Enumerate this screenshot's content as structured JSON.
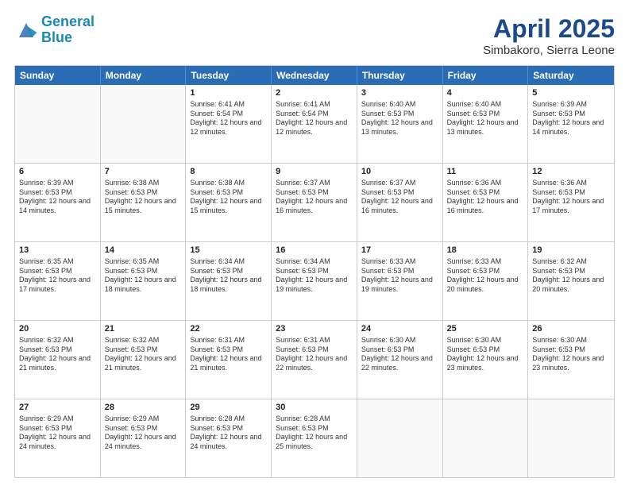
{
  "header": {
    "logo_line1": "General",
    "logo_line2": "Blue",
    "main_title": "April 2025",
    "subtitle": "Simbakoro, Sierra Leone"
  },
  "calendar": {
    "weekdays": [
      "Sunday",
      "Monday",
      "Tuesday",
      "Wednesday",
      "Thursday",
      "Friday",
      "Saturday"
    ],
    "rows": [
      [
        {
          "day": "",
          "empty": true
        },
        {
          "day": "",
          "empty": true
        },
        {
          "day": "1",
          "sunrise": "6:41 AM",
          "sunset": "6:54 PM",
          "daylight": "12 hours and 12 minutes."
        },
        {
          "day": "2",
          "sunrise": "6:41 AM",
          "sunset": "6:54 PM",
          "daylight": "12 hours and 12 minutes."
        },
        {
          "day": "3",
          "sunrise": "6:40 AM",
          "sunset": "6:53 PM",
          "daylight": "12 hours and 13 minutes."
        },
        {
          "day": "4",
          "sunrise": "6:40 AM",
          "sunset": "6:53 PM",
          "daylight": "12 hours and 13 minutes."
        },
        {
          "day": "5",
          "sunrise": "6:39 AM",
          "sunset": "6:53 PM",
          "daylight": "12 hours and 14 minutes."
        }
      ],
      [
        {
          "day": "6",
          "sunrise": "6:39 AM",
          "sunset": "6:53 PM",
          "daylight": "12 hours and 14 minutes."
        },
        {
          "day": "7",
          "sunrise": "6:38 AM",
          "sunset": "6:53 PM",
          "daylight": "12 hours and 15 minutes."
        },
        {
          "day": "8",
          "sunrise": "6:38 AM",
          "sunset": "6:53 PM",
          "daylight": "12 hours and 15 minutes."
        },
        {
          "day": "9",
          "sunrise": "6:37 AM",
          "sunset": "6:53 PM",
          "daylight": "12 hours and 16 minutes."
        },
        {
          "day": "10",
          "sunrise": "6:37 AM",
          "sunset": "6:53 PM",
          "daylight": "12 hours and 16 minutes."
        },
        {
          "day": "11",
          "sunrise": "6:36 AM",
          "sunset": "6:53 PM",
          "daylight": "12 hours and 16 minutes."
        },
        {
          "day": "12",
          "sunrise": "6:36 AM",
          "sunset": "6:53 PM",
          "daylight": "12 hours and 17 minutes."
        }
      ],
      [
        {
          "day": "13",
          "sunrise": "6:35 AM",
          "sunset": "6:53 PM",
          "daylight": "12 hours and 17 minutes."
        },
        {
          "day": "14",
          "sunrise": "6:35 AM",
          "sunset": "6:53 PM",
          "daylight": "12 hours and 18 minutes."
        },
        {
          "day": "15",
          "sunrise": "6:34 AM",
          "sunset": "6:53 PM",
          "daylight": "12 hours and 18 minutes."
        },
        {
          "day": "16",
          "sunrise": "6:34 AM",
          "sunset": "6:53 PM",
          "daylight": "12 hours and 19 minutes."
        },
        {
          "day": "17",
          "sunrise": "6:33 AM",
          "sunset": "6:53 PM",
          "daylight": "12 hours and 19 minutes."
        },
        {
          "day": "18",
          "sunrise": "6:33 AM",
          "sunset": "6:53 PM",
          "daylight": "12 hours and 20 minutes."
        },
        {
          "day": "19",
          "sunrise": "6:32 AM",
          "sunset": "6:53 PM",
          "daylight": "12 hours and 20 minutes."
        }
      ],
      [
        {
          "day": "20",
          "sunrise": "6:32 AM",
          "sunset": "6:53 PM",
          "daylight": "12 hours and 21 minutes."
        },
        {
          "day": "21",
          "sunrise": "6:32 AM",
          "sunset": "6:53 PM",
          "daylight": "12 hours and 21 minutes."
        },
        {
          "day": "22",
          "sunrise": "6:31 AM",
          "sunset": "6:53 PM",
          "daylight": "12 hours and 21 minutes."
        },
        {
          "day": "23",
          "sunrise": "6:31 AM",
          "sunset": "6:53 PM",
          "daylight": "12 hours and 22 minutes."
        },
        {
          "day": "24",
          "sunrise": "6:30 AM",
          "sunset": "6:53 PM",
          "daylight": "12 hours and 22 minutes."
        },
        {
          "day": "25",
          "sunrise": "6:30 AM",
          "sunset": "6:53 PM",
          "daylight": "12 hours and 23 minutes."
        },
        {
          "day": "26",
          "sunrise": "6:30 AM",
          "sunset": "6:53 PM",
          "daylight": "12 hours and 23 minutes."
        }
      ],
      [
        {
          "day": "27",
          "sunrise": "6:29 AM",
          "sunset": "6:53 PM",
          "daylight": "12 hours and 24 minutes."
        },
        {
          "day": "28",
          "sunrise": "6:29 AM",
          "sunset": "6:53 PM",
          "daylight": "12 hours and 24 minutes."
        },
        {
          "day": "29",
          "sunrise": "6:28 AM",
          "sunset": "6:53 PM",
          "daylight": "12 hours and 24 minutes."
        },
        {
          "day": "30",
          "sunrise": "6:28 AM",
          "sunset": "6:53 PM",
          "daylight": "12 hours and 25 minutes."
        },
        {
          "day": "",
          "empty": true
        },
        {
          "day": "",
          "empty": true
        },
        {
          "day": "",
          "empty": true
        }
      ]
    ]
  }
}
